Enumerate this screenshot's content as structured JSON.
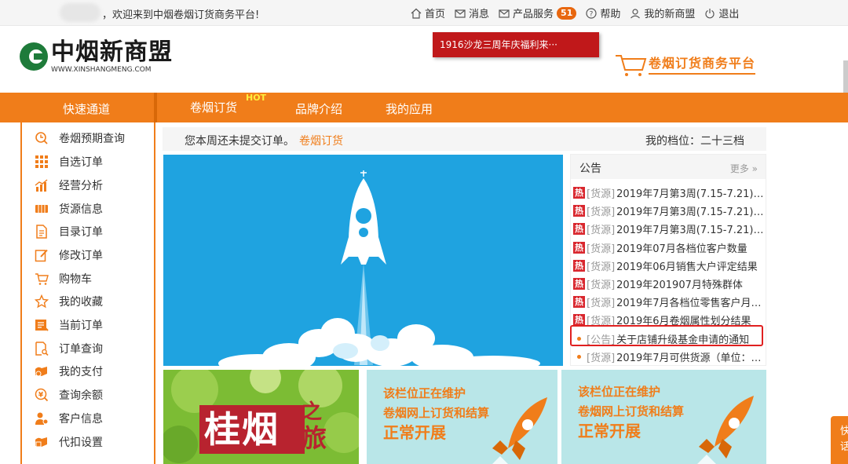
{
  "topbar": {
    "welcome": "，欢迎来到中烟卷烟订货商务平台!",
    "links": [
      {
        "label": "首页",
        "icon": "home-icon"
      },
      {
        "label": "消息",
        "icon": "mail-icon"
      },
      {
        "label": "产品服务",
        "icon": "mail-icon",
        "badge": "51"
      },
      {
        "label": "帮助",
        "icon": "help-icon"
      },
      {
        "label": "我的新商盟",
        "icon": "user-icon"
      },
      {
        "label": "退出",
        "icon": "power-icon"
      }
    ]
  },
  "header": {
    "logo_cn": "中烟新商盟",
    "logo_en": "WWW.XINSHANGMENG.COM",
    "promo": "1916沙龙三周年庆福利来···",
    "platform": "卷烟订货商务平台"
  },
  "nav": {
    "quick": "快速通道",
    "tabs": [
      {
        "label": "卷烟订货",
        "hot": "HOT"
      },
      {
        "label": "品牌介绍"
      },
      {
        "label": "我的应用"
      }
    ]
  },
  "sidebar": {
    "items": [
      {
        "label": "卷烟预期查询",
        "icon": "clock-search-icon"
      },
      {
        "label": "自选订单",
        "icon": "grid-icon"
      },
      {
        "label": "经营分析",
        "icon": "chart-icon"
      },
      {
        "label": "货源信息",
        "icon": "box-icon"
      },
      {
        "label": "目录订单",
        "icon": "document-icon"
      },
      {
        "label": "修改订单",
        "icon": "edit-icon"
      },
      {
        "label": "购物车",
        "icon": "cart-icon"
      },
      {
        "label": "我的收藏",
        "icon": "star-icon"
      },
      {
        "label": "当前订单",
        "icon": "order-icon"
      },
      {
        "label": "订单查询",
        "icon": "search-doc-icon"
      },
      {
        "label": "我的支付",
        "icon": "payment-icon"
      },
      {
        "label": "查询余额",
        "icon": "balance-icon"
      },
      {
        "label": "客户信息",
        "icon": "customer-icon"
      },
      {
        "label": "代扣设置",
        "icon": "settings-icon"
      }
    ]
  },
  "notice": {
    "message": "您本周还未提交订单。",
    "link": "卷烟订货",
    "grade": "我的档位：二十三档"
  },
  "announcements": {
    "title": "公告",
    "more": "更多 »",
    "items": [
      {
        "type": "hot",
        "hot_mark": "热",
        "tag": "[货源]",
        "title": "2019年7月第3周(7.15-7.21)…"
      },
      {
        "type": "hot",
        "hot_mark": "热",
        "tag": "[货源]",
        "title": "2019年7月第3周(7.15-7.21)…"
      },
      {
        "type": "hot",
        "hot_mark": "热",
        "tag": "[货源]",
        "title": "2019年7月第3周(7.15-7.21)…"
      },
      {
        "type": "hot",
        "hot_mark": "热",
        "tag": "[货源]",
        "title": "2019年07月各档位客户数量"
      },
      {
        "type": "hot",
        "hot_mark": "热",
        "tag": "[货源]",
        "title": "2019年06月销售大户评定结果"
      },
      {
        "type": "hot",
        "hot_mark": "热",
        "tag": "[货源]",
        "title": "2019年201907月特殊群体"
      },
      {
        "type": "hot",
        "hot_mark": "热",
        "tag": "[货源]",
        "title": "2019年7月各档位零售客户月…"
      },
      {
        "type": "hot",
        "hot_mark": "热",
        "tag": "[货源]",
        "title": "2019年6月卷烟属性划分结果"
      },
      {
        "type": "dot",
        "tag": "[公告]",
        "title": "关于店铺升级基金申请的通知"
      },
      {
        "type": "dot",
        "tag": "[货源]",
        "title": "2019年7月可供货源（单位：…"
      }
    ]
  },
  "tiles": {
    "guiyan": {
      "main": "桂烟",
      "zhi": "之",
      "lv": "旅"
    },
    "maint1": {
      "line1": "该栏位正在维护",
      "line2": "卷烟网上订货和结算",
      "line3": "正常开展"
    },
    "maint2": {
      "line1": "该栏位正在维护",
      "line2": "卷烟网上订货和结算",
      "line3": "正常开展"
    }
  },
  "float": {
    "label": "快\n话"
  },
  "colors": {
    "accent": "#f07d1a",
    "banner": "#1fa3e0",
    "hot": "#d9272e",
    "promo": "#c0181a"
  }
}
